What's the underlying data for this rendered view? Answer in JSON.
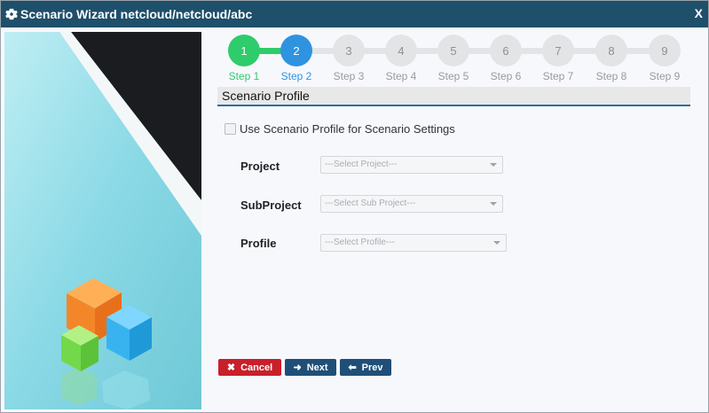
{
  "window": {
    "title": "Scenario Wizard netcloud/netcloud/abc",
    "close_label": "X"
  },
  "stepper": {
    "steps": [
      {
        "number": "1",
        "label": "Step 1",
        "state": "done"
      },
      {
        "number": "2",
        "label": "Step 2",
        "state": "active"
      },
      {
        "number": "3",
        "label": "Step 3",
        "state": "pending"
      },
      {
        "number": "4",
        "label": "Step 4",
        "state": "pending"
      },
      {
        "number": "5",
        "label": "Step 5",
        "state": "pending"
      },
      {
        "number": "6",
        "label": "Step 6",
        "state": "pending"
      },
      {
        "number": "7",
        "label": "Step 7",
        "state": "pending"
      },
      {
        "number": "8",
        "label": "Step 8",
        "state": "pending"
      },
      {
        "number": "9",
        "label": "Step 9",
        "state": "pending"
      }
    ]
  },
  "section": {
    "title": "Scenario Profile"
  },
  "form": {
    "use_profile_label": "Use Scenario Profile for Scenario Settings",
    "use_profile_checked": false,
    "project_label": "Project",
    "project_value": "---Select Project---",
    "subproject_label": "SubProject",
    "subproject_value": "---Select Sub Project---",
    "profile_label": "Profile",
    "profile_value": "---Select Profile---"
  },
  "buttons": {
    "cancel_label": "Cancel",
    "next_label": "Next",
    "prev_label": "Prev"
  },
  "colors": {
    "titlebar": "#1e4f6b",
    "step_done": "#2ecc6b",
    "step_active": "#2f93e0",
    "step_pending": "#e2e4e6",
    "cancel": "#c8202a",
    "nav_button": "#1f4f78"
  }
}
